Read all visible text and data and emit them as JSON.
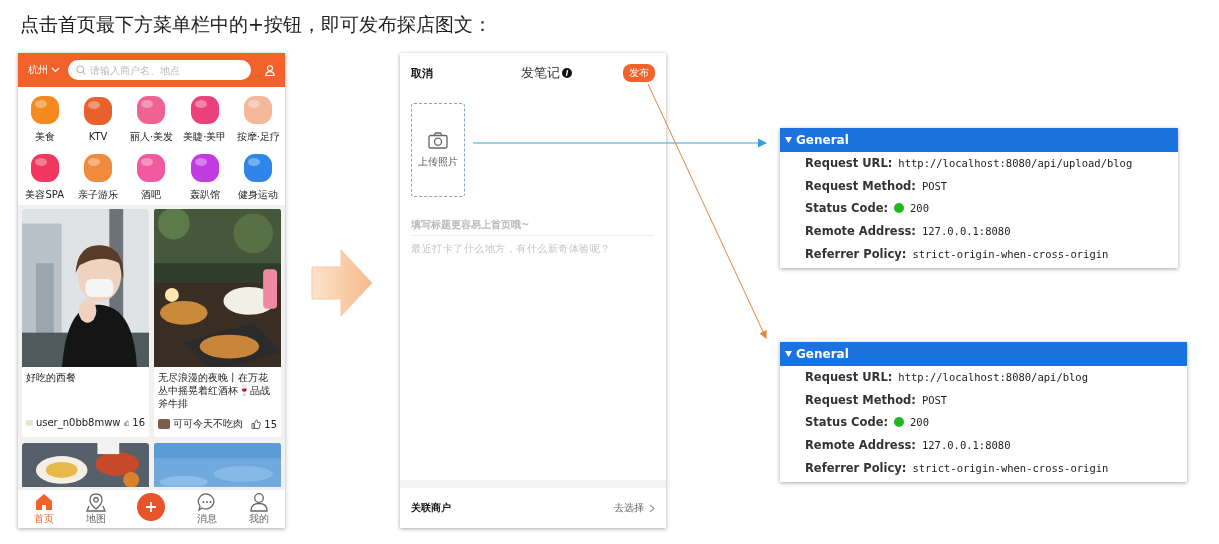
{
  "caption": "点击首页最下方菜单栏中的+按钮，即可发布探店图文：",
  "home_screen": {
    "city": "杭州",
    "search": {
      "placeholder": "请输入商户名、地点"
    },
    "categories": [
      {
        "label": "美食",
        "color": "#f5891f"
      },
      {
        "label": "KTV",
        "color": "#e8602c"
      },
      {
        "label": "丽人·美发",
        "color": "#f06292"
      },
      {
        "label": "美睫·美甲",
        "color": "#ec407a"
      },
      {
        "label": "按摩·足疗",
        "color": "#f4b79a"
      },
      {
        "label": "美容SPA",
        "color": "#f2365f"
      },
      {
        "label": "亲子游乐",
        "color": "#f08a3c"
      },
      {
        "label": "酒吧",
        "color": "#f25aa0"
      },
      {
        "label": "轰趴馆",
        "color": "#c03be0"
      },
      {
        "label": "健身运动",
        "color": "#2f86e8"
      }
    ],
    "posts": [
      {
        "kind": "picture",
        "title": "好吃的西餐",
        "author": "user_n0bb8mww",
        "likes": "16"
      },
      {
        "kind": "picture",
        "title": "无尽浪漫的夜晚丨在万花丛中摇晃着红酒杯🍷品战斧牛排",
        "author": "可可今天不吃肉",
        "likes": "15"
      },
      {
        "kind": "picture"
      },
      {
        "kind": "picture"
      }
    ],
    "tab_bar": [
      {
        "kind": "home",
        "label": "首页",
        "selected": true
      },
      {
        "kind": "map",
        "label": "地图",
        "selected": false
      },
      {
        "kind": "add",
        "selected": false
      },
      {
        "kind": "chat",
        "label": "消息",
        "selected": false
      },
      {
        "kind": "user",
        "label": "我的",
        "selected": false
      }
    ]
  },
  "editor_screen": {
    "cancel": "取消",
    "title": "发笔记",
    "publish": "发布",
    "upload": "上传照片",
    "title_field": {
      "placeholder": "填写标题更容易上首页哦~"
    },
    "body_field": {
      "placeholder": "最近打卡了什么地方，有什么新奇体验呢？"
    },
    "merchant": {
      "label": "关联商户",
      "action": "去选择"
    }
  },
  "requests": [
    {
      "heading": "General",
      "expanded": true,
      "rows": [
        {
          "label": "Request URL:",
          "value": "http://localhost:8080/api/upload/blog"
        },
        {
          "label": "Request Method:",
          "value": "POST"
        },
        {
          "label": "Status Code:",
          "value": "200",
          "color": "#1fb81f"
        },
        {
          "label": "Remote Address:",
          "value": "127.0.0.1:8080"
        },
        {
          "label": "Referrer Policy:",
          "value": "strict-origin-when-cross-origin"
        }
      ]
    },
    {
      "heading": "General",
      "expanded": true,
      "rows": [
        {
          "label": "Request URL:",
          "value": "http://localhost:8080/api/blog"
        },
        {
          "label": "Request Method:",
          "value": "POST"
        },
        {
          "label": "Status Code:",
          "value": "200",
          "color": "#1fb81f"
        },
        {
          "label": "Remote Address:",
          "value": "127.0.0.1:8080"
        },
        {
          "label": "Referrer Policy:",
          "value": "strict-origin-when-cross-origin"
        }
      ]
    }
  ]
}
